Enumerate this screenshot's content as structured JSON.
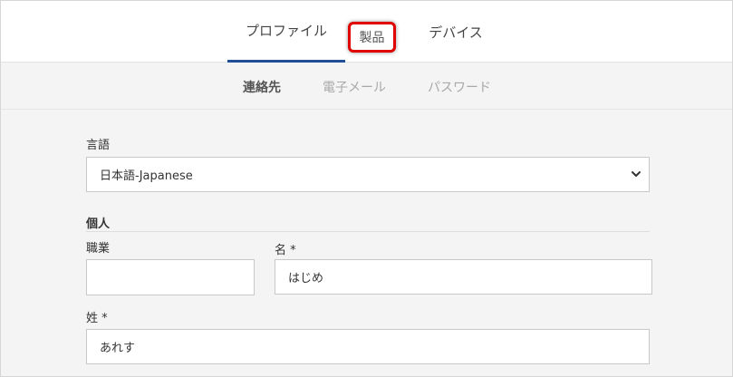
{
  "tabs": {
    "profile": "プロファイル",
    "products": "製品",
    "devices": "デバイス"
  },
  "subtabs": {
    "contact": "連絡先",
    "email": "電子メール",
    "password": "パスワード"
  },
  "form": {
    "language_label": "言語",
    "language_value": "日本語-Japanese",
    "personal_section": "個人",
    "occupation_label": "職業",
    "occupation_value": "",
    "first_name_label": "名 *",
    "first_name_value": "はじめ",
    "last_name_label": "姓 *",
    "last_name_value": "あれす"
  },
  "colors": {
    "active_tab_underline": "#1f4e96",
    "highlight": "#e00000"
  },
  "icons": {
    "select_arrow": "chevron-down-icon"
  }
}
